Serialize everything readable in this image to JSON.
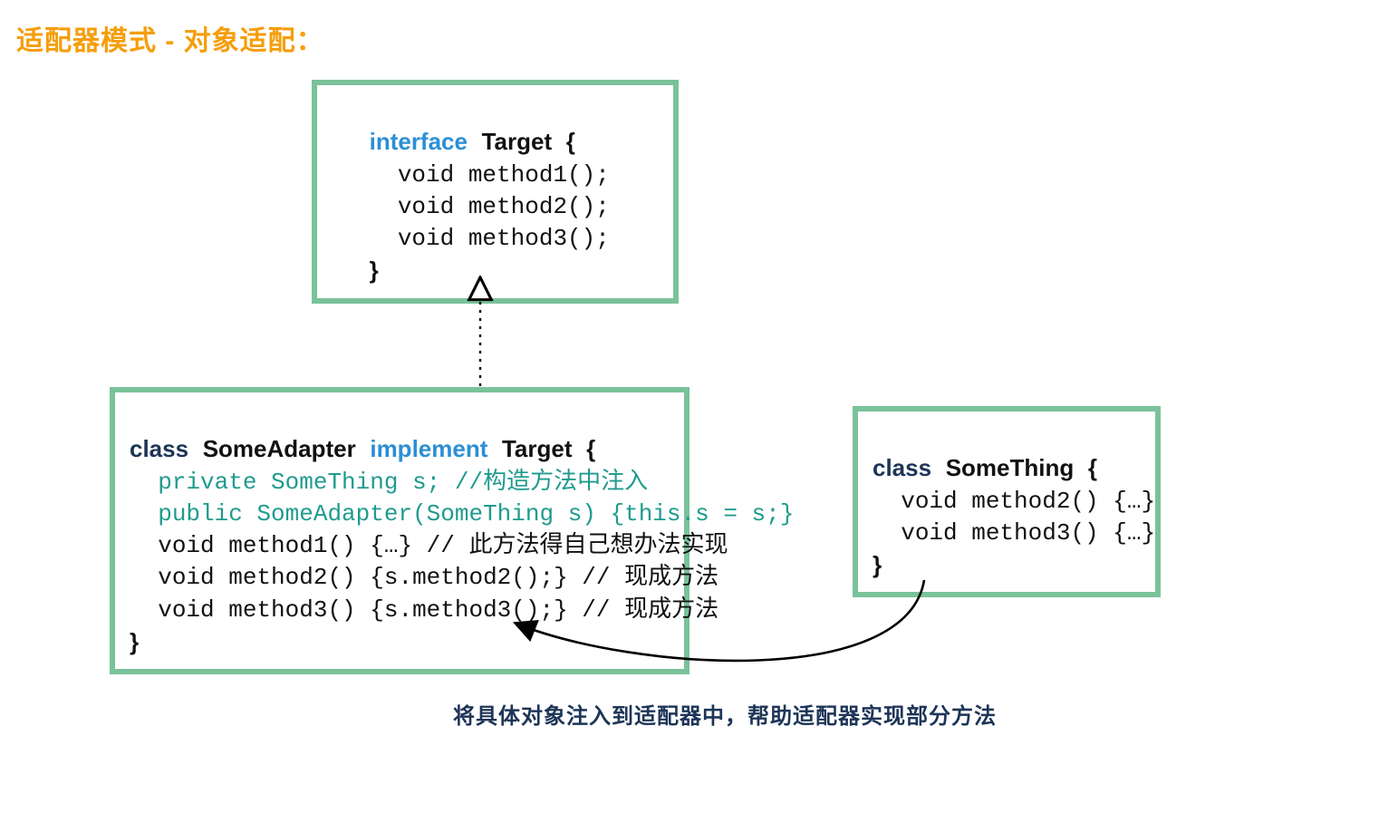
{
  "title": "适配器模式 - 对象适配：",
  "target": {
    "head_kw": "interface",
    "head_name": "Target",
    "head_brace": "{",
    "l1": "void method1();",
    "l2": "void method2();",
    "l3": "void method3();",
    "close": "}"
  },
  "adapter": {
    "kw_class": "class",
    "name": "SomeAdapter",
    "kw_impl": "implement",
    "impl_name": "Target",
    "head_brace": "{",
    "l1": "private SomeThing s; //构造方法中注入",
    "l2": "public SomeAdapter(SomeThing s) {this.s = s;}",
    "l3": "void method1() {…} // 此方法得自己想办法实现",
    "l4": "void method2() {s.method2();} // 现成方法",
    "l5": "void method3() {s.method3();} // 现成方法",
    "close": "}"
  },
  "something": {
    "kw_class": "class",
    "name": "SomeThing",
    "head_brace": "{",
    "l1": "void method2() {…}",
    "l2": "void method3() {…}",
    "close": "}"
  },
  "caption": "将具体对象注入到适配器中，帮助适配器实现部分方法"
}
